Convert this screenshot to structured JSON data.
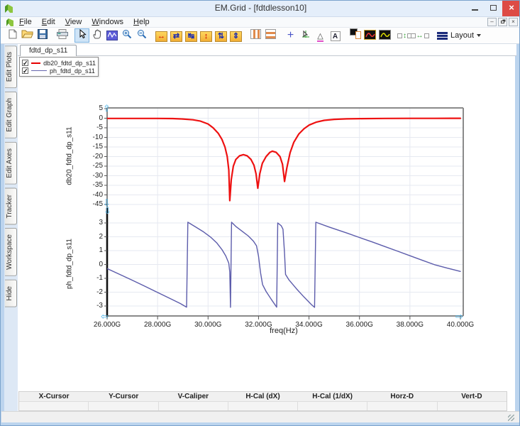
{
  "window": {
    "title": "EM.Grid - [fdtdlesson10]"
  },
  "menu": {
    "items": [
      "File",
      "Edit",
      "View",
      "Windows",
      "Help"
    ]
  },
  "toolbar": {
    "layout_label": "Layout",
    "buttons": [
      {
        "name": "new",
        "group": 1
      },
      {
        "name": "open",
        "group": 1
      },
      {
        "name": "save",
        "group": 1
      },
      {
        "name": "print",
        "group": 2
      },
      {
        "name": "select",
        "group": 3
      },
      {
        "name": "pan",
        "group": 3
      },
      {
        "name": "zoom-box",
        "group": 3
      },
      {
        "name": "zoom-in",
        "group": 3
      },
      {
        "name": "zoom-out",
        "group": 3
      },
      {
        "name": "x-expand",
        "group": 4
      },
      {
        "name": "x-shrink",
        "group": 4
      },
      {
        "name": "x-fit",
        "group": 4
      },
      {
        "name": "y-expand",
        "group": 4
      },
      {
        "name": "y-shrink",
        "group": 4
      },
      {
        "name": "y-fit",
        "group": 4
      },
      {
        "name": "vertical-bars",
        "group": 5
      },
      {
        "name": "horizontal-bars",
        "group": 5
      },
      {
        "name": "cross-cursor",
        "group": 6
      },
      {
        "name": "tracker",
        "group": 6
      },
      {
        "name": "delta-caliper",
        "group": 6
      },
      {
        "name": "annotation",
        "group": 6
      },
      {
        "name": "copy-plot",
        "group": 7
      },
      {
        "name": "plot-dark-red",
        "group": 7
      },
      {
        "name": "plot-dark-yellow",
        "group": 7
      },
      {
        "name": "equal-v-space",
        "group": 8
      },
      {
        "name": "equal-h-space",
        "group": 8
      }
    ],
    "active_button": "select"
  },
  "sidebar": {
    "tabs": [
      "Edit Plots",
      "Edit Graph",
      "Edit Axes",
      "Tracker",
      "Workspace",
      "Hide"
    ]
  },
  "doc_tabs": {
    "active": "fdtd_dp_s11"
  },
  "legend": {
    "items": [
      {
        "label": "db20_fdtd_dp_s11",
        "color": "#e60000",
        "checked": true,
        "check_glyph": "✓"
      },
      {
        "label": "ph_fdtd_dp_s11",
        "color": "#6565ae",
        "checked": true,
        "check_glyph": "✓"
      }
    ]
  },
  "cursor_table": {
    "headers": [
      "X-Cursor",
      "Y-Cursor",
      "V-Caliper",
      "H-Cal (dX)",
      "H-Cal (1/dX)",
      "Horz-D",
      "Vert-D"
    ],
    "values": [
      "",
      "",
      "",
      "",
      "",
      "",
      ""
    ]
  },
  "colors": {
    "db20_curve": "#ee1111",
    "phase_curve": "#5c5cab",
    "grid": "#e6e9f1",
    "frame": "#8a8a8a",
    "selected_axis": "#111111",
    "handle": "#49b2e8",
    "titlebar": "#e4eefa",
    "close_button": "#dd4b45"
  },
  "chart_data": {
    "type": "line",
    "xlabel": "freq(Hz)",
    "xlim": [
      26,
      40
    ],
    "xticks": [
      26,
      28,
      30,
      32,
      34,
      36,
      38,
      40
    ],
    "xtick_labels": [
      "26.000G",
      "28.000G",
      "30.000G",
      "32.000G",
      "34.000G",
      "36.000G",
      "38.000G",
      "40.000G"
    ],
    "grid": true,
    "legend_position": "top-left",
    "subplots": [
      {
        "ylabel": "db20_fdtd_dp_s11",
        "ylim": [
          -47.5,
          5.4
        ],
        "yticks": [
          5,
          0,
          -5,
          -10,
          -15,
          -20,
          -25,
          -30,
          -35,
          -40,
          -45
        ],
        "series": {
          "name": "db20_fdtd_dp_s11",
          "color": "#ee1111",
          "width": 2.2,
          "points": [
            [
              26.0,
              -0.1
            ],
            [
              27.0,
              -0.1
            ],
            [
              28.0,
              -0.12
            ],
            [
              28.6,
              -0.2
            ],
            [
              29.0,
              -0.4
            ],
            [
              29.4,
              -0.8
            ],
            [
              29.7,
              -1.5
            ],
            [
              30.0,
              -3.0
            ],
            [
              30.2,
              -5.0
            ],
            [
              30.4,
              -7.8
            ],
            [
              30.55,
              -11
            ],
            [
              30.67,
              -15
            ],
            [
              30.76,
              -20
            ],
            [
              30.82,
              -27
            ],
            [
              30.86,
              -43
            ],
            [
              30.92,
              -32
            ],
            [
              31.0,
              -25
            ],
            [
              31.1,
              -21.5
            ],
            [
              31.25,
              -19.6
            ],
            [
              31.4,
              -19.0
            ],
            [
              31.55,
              -19.6
            ],
            [
              31.7,
              -21.5
            ],
            [
              31.82,
              -24.5
            ],
            [
              31.9,
              -29
            ],
            [
              31.97,
              -36.5
            ],
            [
              32.05,
              -29
            ],
            [
              32.15,
              -23.5
            ],
            [
              32.3,
              -20
            ],
            [
              32.45,
              -17.8
            ],
            [
              32.55,
              -17.2
            ],
            [
              32.7,
              -17.8
            ],
            [
              32.85,
              -20
            ],
            [
              32.95,
              -24
            ],
            [
              33.03,
              -33
            ],
            [
              33.12,
              -26
            ],
            [
              33.25,
              -18
            ],
            [
              33.4,
              -12.5
            ],
            [
              33.6,
              -8.2
            ],
            [
              33.8,
              -5.5
            ],
            [
              34.0,
              -3.6
            ],
            [
              34.3,
              -2.0
            ],
            [
              34.6,
              -1.1
            ],
            [
              35.0,
              -0.6
            ],
            [
              35.5,
              -0.35
            ],
            [
              36.0,
              -0.22
            ],
            [
              37.0,
              -0.12
            ],
            [
              38.0,
              -0.08
            ],
            [
              39.0,
              -0.06
            ],
            [
              40.0,
              -0.05
            ]
          ]
        }
      },
      {
        "ylabel": "ph_fdtd_dp_s11",
        "ylim": [
          -3.7,
          4.0
        ],
        "yticks": [
          3,
          2,
          1,
          0,
          -1,
          -2,
          -3
        ],
        "series": {
          "name": "ph_fdtd_dp_s11",
          "color": "#5c5cab",
          "width": 1.4,
          "points": [
            [
              26.0,
              -0.3
            ],
            [
              26.5,
              -0.72
            ],
            [
              27.0,
              -1.14
            ],
            [
              27.5,
              -1.58
            ],
            [
              28.0,
              -2.02
            ],
            [
              28.5,
              -2.46
            ],
            [
              28.9,
              -2.82
            ],
            [
              29.15,
              -3.08
            ],
            [
              29.2,
              3.05
            ],
            [
              29.5,
              2.72
            ],
            [
              29.8,
              2.38
            ],
            [
              30.1,
              1.98
            ],
            [
              30.35,
              1.55
            ],
            [
              30.55,
              1.08
            ],
            [
              30.7,
              0.62
            ],
            [
              30.82,
              0.1
            ],
            [
              30.86,
              -0.55
            ],
            [
              30.89,
              -3.1
            ],
            [
              30.93,
              3.05
            ],
            [
              31.1,
              2.75
            ],
            [
              31.35,
              2.4
            ],
            [
              31.6,
              2.05
            ],
            [
              31.8,
              1.68
            ],
            [
              31.92,
              1.35
            ],
            [
              32.0,
              0.6
            ],
            [
              32.08,
              -0.6
            ],
            [
              32.16,
              -1.45
            ],
            [
              32.3,
              -1.95
            ],
            [
              32.5,
              -2.5
            ],
            [
              32.72,
              -3.08
            ],
            [
              32.76,
              3.0
            ],
            [
              32.9,
              2.8
            ],
            [
              32.97,
              2.55
            ],
            [
              33.03,
              0.8
            ],
            [
              33.07,
              -0.72
            ],
            [
              33.2,
              -1.1
            ],
            [
              33.5,
              -1.75
            ],
            [
              33.8,
              -2.35
            ],
            [
              34.1,
              -2.9
            ],
            [
              34.22,
              -3.1
            ],
            [
              34.27,
              3.05
            ],
            [
              34.8,
              2.7
            ],
            [
              35.5,
              2.27
            ],
            [
              36.0,
              1.95
            ],
            [
              36.5,
              1.63
            ],
            [
              37.0,
              1.3
            ],
            [
              37.5,
              0.97
            ],
            [
              38.0,
              0.63
            ],
            [
              38.5,
              0.3
            ],
            [
              39.0,
              -0.03
            ],
            [
              39.5,
              -0.27
            ],
            [
              40.0,
              -0.5
            ]
          ]
        }
      }
    ]
  }
}
